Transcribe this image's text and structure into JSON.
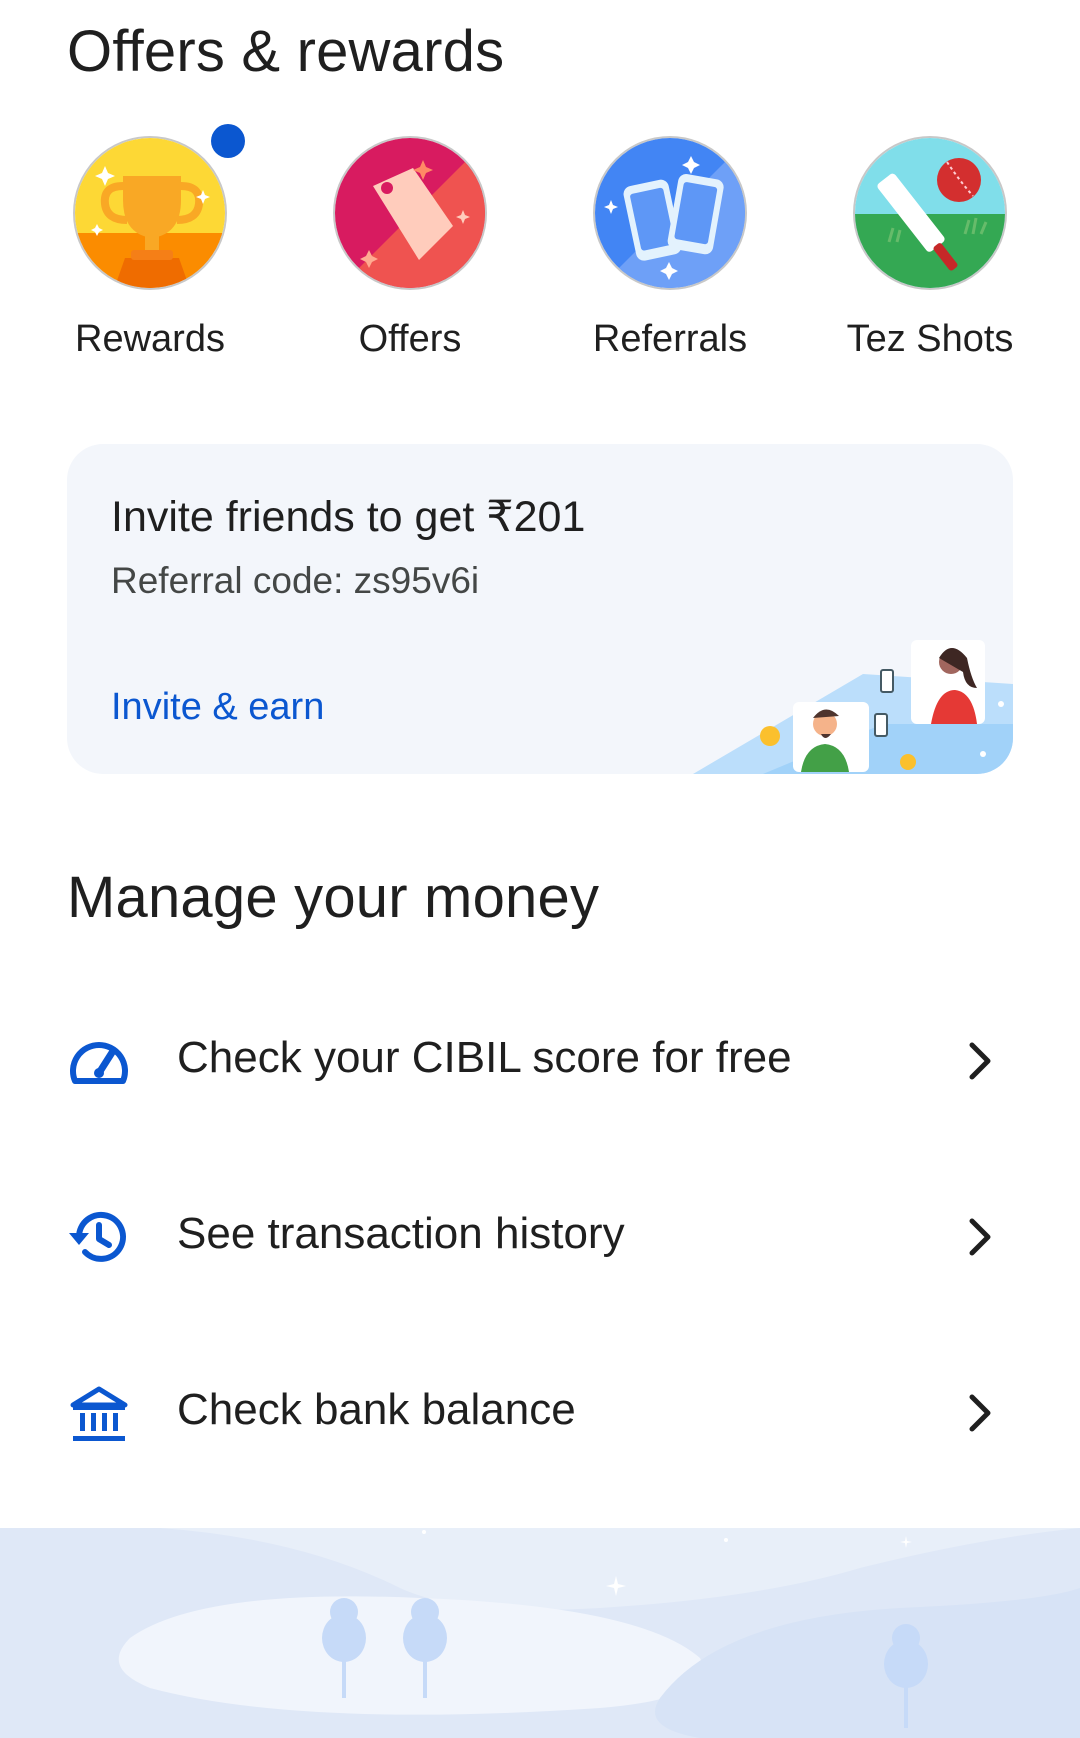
{
  "offers_section": {
    "title": "Offers & rewards",
    "tiles": [
      {
        "label": "Rewards",
        "icon": "trophy-icon",
        "has_badge": true
      },
      {
        "label": "Offers",
        "icon": "tag-icon",
        "has_badge": false
      },
      {
        "label": "Referrals",
        "icon": "phones-icon",
        "has_badge": false
      },
      {
        "label": "Tez Shots",
        "icon": "cricket-icon",
        "has_badge": false
      }
    ]
  },
  "invite_card": {
    "title": "Invite friends to get ₹201",
    "referral_code": "Referral code: zs95v6i",
    "link": "Invite & earn"
  },
  "manage_section": {
    "title": "Manage your money",
    "items": [
      {
        "label": "Check your CIBIL score for free",
        "icon": "speedometer-icon"
      },
      {
        "label": "See transaction history",
        "icon": "history-icon"
      },
      {
        "label": "Check bank balance",
        "icon": "bank-icon"
      }
    ]
  },
  "colors": {
    "accent": "#0b57d0",
    "card_bg": "#f3f6fb",
    "text_primary": "#1f1f1f",
    "text_secondary": "#444746"
  }
}
